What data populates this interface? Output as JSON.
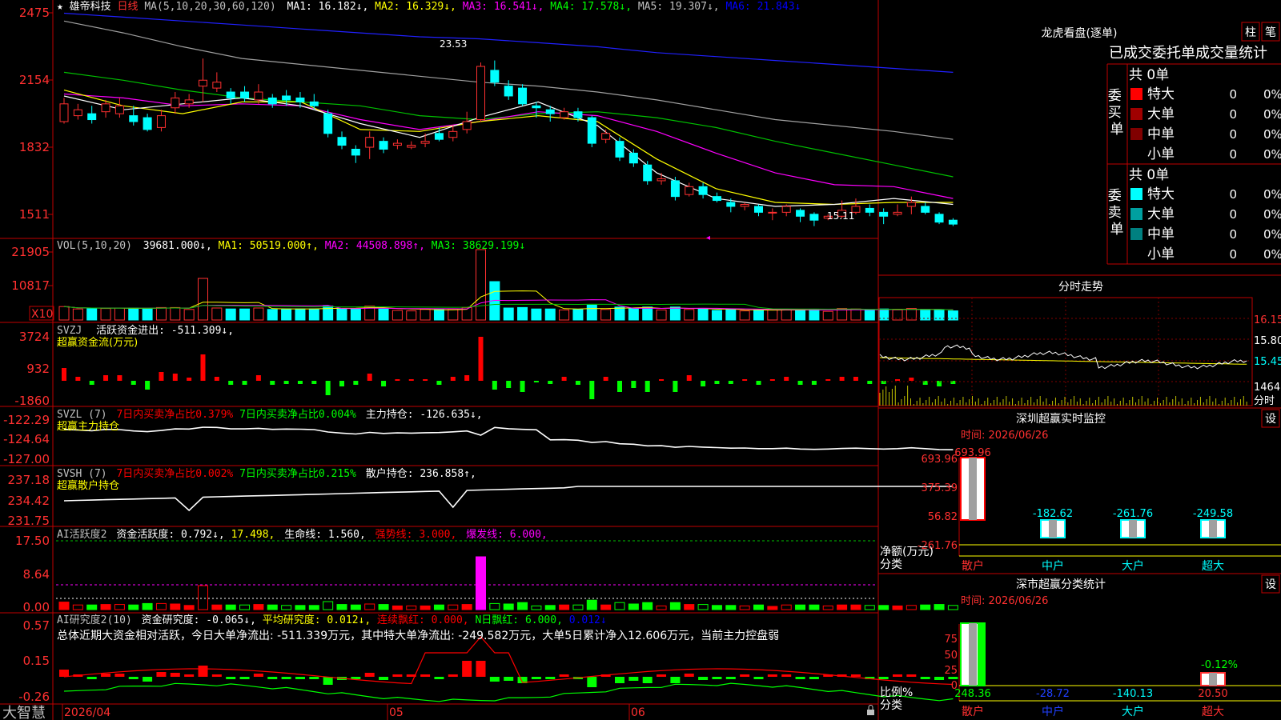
{
  "stock": {
    "star": "★",
    "name": "雄帝科技",
    "period": "日线"
  },
  "ma_line": {
    "label": "MA(5,10,20,30,60,120)",
    "items": [
      {
        "text": "MA1: 16.182↓,",
        "color": "#ffffff"
      },
      {
        "text": "MA2: 16.329↓,",
        "color": "#ffff00"
      },
      {
        "text": "MA3: 16.541↓,",
        "color": "#ff00ff"
      },
      {
        "text": "MA4: 17.578↓,",
        "color": "#00ff00"
      },
      {
        "text": "MA5: 19.307↓,",
        "color": "#c0c0c0"
      },
      {
        "text": "MA6: 21.843↓",
        "color": "#0000ff"
      }
    ]
  },
  "price_panel": {
    "ticks": [
      "2475",
      "2154",
      "1832",
      "1511"
    ],
    "high_label": "23.53",
    "low_label": "15.11",
    "ma_series": [
      {
        "name": "MA6",
        "color": "#2020ff",
        "values": [
          25.9,
          25.7,
          25.5,
          25.3,
          25.1,
          24.9,
          24.7,
          24.6,
          24.4,
          24.2,
          23.9,
          23.7,
          23.5,
          23.3,
          23.1,
          22.9
        ]
      },
      {
        "name": "MA5",
        "color": "#a0a0a0",
        "values": [
          25.5,
          24.9,
          24.2,
          23.6,
          23.3,
          23.0,
          22.7,
          22.4,
          22.2,
          21.9,
          21.5,
          21.0,
          20.5,
          20.2,
          19.9,
          19.5
        ]
      },
      {
        "name": "MA4",
        "color": "#00c000",
        "values": [
          22.9,
          22.5,
          22.0,
          21.6,
          21.4,
          21.2,
          20.7,
          20.5,
          20.8,
          20.9,
          20.6,
          20.1,
          19.4,
          18.8,
          18.2,
          17.6
        ]
      },
      {
        "name": "MA3",
        "color": "#ff00ff",
        "values": [
          21.8,
          21.6,
          21.2,
          21.3,
          21.2,
          20.5,
          20.0,
          20.4,
          20.9,
          20.7,
          19.9,
          18.8,
          17.8,
          17.2,
          17.1,
          16.5
        ]
      },
      {
        "name": "MA2",
        "color": "#ffff00",
        "values": [
          22.0,
          21.2,
          20.8,
          21.4,
          21.4,
          20.0,
          19.9,
          20.4,
          20.7,
          20.4,
          18.5,
          17.0,
          16.3,
          16.2,
          16.3,
          16.3
        ]
      },
      {
        "name": "MA1",
        "color": "#ffffff",
        "values": [
          21.7,
          21.0,
          21.3,
          21.6,
          21.2,
          20.3,
          19.6,
          20.6,
          21.4,
          20.2,
          17.8,
          16.5,
          16.1,
          16.2,
          16.5,
          16.2
        ]
      }
    ],
    "candles": [
      {
        "o": 20.4,
        "c": 21.3,
        "h": 21.6,
        "l": 20.3
      },
      {
        "o": 20.7,
        "c": 21.0,
        "h": 21.3,
        "l": 20.5
      },
      {
        "o": 20.8,
        "c": 20.5,
        "h": 21.2,
        "l": 20.3
      },
      {
        "o": 20.9,
        "c": 21.3,
        "h": 21.5,
        "l": 20.6
      },
      {
        "o": 20.8,
        "c": 21.2,
        "h": 21.6,
        "l": 20.6
      },
      {
        "o": 20.7,
        "c": 20.4,
        "h": 21.2,
        "l": 20.2
      },
      {
        "o": 20.6,
        "c": 20.0,
        "h": 20.8,
        "l": 19.9
      },
      {
        "o": 20.1,
        "c": 20.7,
        "h": 21.0,
        "l": 19.9
      },
      {
        "o": 21.1,
        "c": 21.6,
        "h": 21.9,
        "l": 20.8
      },
      {
        "o": 21.3,
        "c": 21.5,
        "h": 21.8,
        "l": 21.1
      },
      {
        "o": 22.2,
        "c": 22.5,
        "h": 23.6,
        "l": 21.4
      },
      {
        "o": 22.1,
        "c": 22.4,
        "h": 22.9,
        "l": 21.9
      },
      {
        "o": 21.9,
        "c": 21.6,
        "h": 22.1,
        "l": 21.3
      },
      {
        "o": 21.9,
        "c": 21.6,
        "h": 22.2,
        "l": 21.4
      },
      {
        "o": 21.5,
        "c": 21.9,
        "h": 22.3,
        "l": 21.3
      },
      {
        "o": 21.6,
        "c": 21.3,
        "h": 21.8,
        "l": 21.1
      },
      {
        "o": 21.7,
        "c": 21.5,
        "h": 22.0,
        "l": 21.2
      },
      {
        "o": 21.6,
        "c": 21.4,
        "h": 21.9,
        "l": 21.1
      },
      {
        "o": 21.4,
        "c": 21.2,
        "h": 21.8,
        "l": 21.0
      },
      {
        "o": 20.8,
        "c": 19.8,
        "h": 21.0,
        "l": 19.6
      },
      {
        "o": 19.6,
        "c": 19.2,
        "h": 19.9,
        "l": 19.0
      },
      {
        "o": 19.0,
        "c": 18.7,
        "h": 19.2,
        "l": 18.3
      },
      {
        "o": 19.1,
        "c": 19.6,
        "h": 19.9,
        "l": 18.5
      },
      {
        "o": 19.4,
        "c": 19.0,
        "h": 19.6,
        "l": 18.8
      },
      {
        "o": 19.2,
        "c": 19.3,
        "h": 19.5,
        "l": 19.0
      },
      {
        "o": 19.1,
        "c": 19.2,
        "h": 19.4,
        "l": 19.0
      },
      {
        "o": 19.3,
        "c": 19.4,
        "h": 19.8,
        "l": 19.1
      },
      {
        "o": 19.8,
        "c": 19.5,
        "h": 20.1,
        "l": 19.4
      },
      {
        "o": 19.6,
        "c": 19.9,
        "h": 20.2,
        "l": 19.4
      },
      {
        "o": 20.0,
        "c": 20.4,
        "h": 20.9,
        "l": 19.8
      },
      {
        "o": 20.5,
        "c": 23.2,
        "h": 23.4,
        "l": 20.4
      },
      {
        "o": 23.0,
        "c": 22.4,
        "h": 23.5,
        "l": 22.2
      },
      {
        "o": 22.2,
        "c": 21.7,
        "h": 22.5,
        "l": 21.5
      },
      {
        "o": 22.1,
        "c": 21.3,
        "h": 22.3,
        "l": 21.2
      },
      {
        "o": 21.2,
        "c": 21.1,
        "h": 21.4,
        "l": 20.6
      },
      {
        "o": 21.0,
        "c": 20.8,
        "h": 21.2,
        "l": 20.4
      },
      {
        "o": 20.6,
        "c": 20.9,
        "h": 21.1,
        "l": 20.5
      },
      {
        "o": 20.9,
        "c": 20.6,
        "h": 21.1,
        "l": 20.4
      },
      {
        "o": 20.6,
        "c": 19.3,
        "h": 20.7,
        "l": 19.1
      },
      {
        "o": 19.5,
        "c": 19.8,
        "h": 20.0,
        "l": 19.3
      },
      {
        "o": 19.4,
        "c": 18.6,
        "h": 19.6,
        "l": 18.4
      },
      {
        "o": 18.8,
        "c": 18.3,
        "h": 19.0,
        "l": 18.1
      },
      {
        "o": 18.2,
        "c": 17.4,
        "h": 18.4,
        "l": 17.2
      },
      {
        "o": 17.4,
        "c": 17.5,
        "h": 17.8,
        "l": 17.2
      },
      {
        "o": 17.4,
        "c": 16.6,
        "h": 17.6,
        "l": 16.4
      },
      {
        "o": 16.7,
        "c": 17.1,
        "h": 17.3,
        "l": 16.6
      },
      {
        "o": 17.1,
        "c": 16.7,
        "h": 17.3,
        "l": 16.5
      },
      {
        "o": 16.6,
        "c": 16.4,
        "h": 16.8,
        "l": 16.3
      },
      {
        "o": 16.3,
        "c": 16.1,
        "h": 16.5,
        "l": 15.8
      },
      {
        "o": 16.1,
        "c": 16.2,
        "h": 16.3,
        "l": 15.9
      },
      {
        "o": 16.1,
        "c": 15.8,
        "h": 16.2,
        "l": 15.6
      },
      {
        "o": 15.8,
        "c": 15.8,
        "h": 16.0,
        "l": 15.4
      },
      {
        "o": 15.8,
        "c": 16.1,
        "h": 16.2,
        "l": 15.6
      },
      {
        "o": 15.9,
        "c": 15.6,
        "h": 16.0,
        "l": 15.3
      },
      {
        "o": 15.7,
        "c": 15.4,
        "h": 15.8,
        "l": 15.1
      },
      {
        "o": 15.5,
        "c": 15.6,
        "h": 15.7,
        "l": 15.4
      },
      {
        "o": 15.6,
        "c": 15.9,
        "h": 16.4,
        "l": 15.5
      },
      {
        "o": 15.8,
        "c": 16.1,
        "h": 16.5,
        "l": 15.7
      },
      {
        "o": 16.0,
        "c": 15.8,
        "h": 16.2,
        "l": 15.6
      },
      {
        "o": 15.8,
        "c": 15.6,
        "h": 16.0,
        "l": 15.2
      },
      {
        "o": 15.7,
        "c": 15.8,
        "h": 16.2,
        "l": 15.6
      },
      {
        "o": 16.1,
        "c": 16.3,
        "h": 16.6,
        "l": 15.7
      },
      {
        "o": 16.1,
        "c": 15.8,
        "h": 16.3,
        "l": 15.7
      },
      {
        "o": 15.7,
        "c": 15.3,
        "h": 15.8,
        "l": 15.2
      },
      {
        "o": 15.4,
        "c": 15.2,
        "h": 15.5,
        "l": 15.1
      }
    ]
  },
  "vol_panel": {
    "label": "VOL(5,10,20)",
    "items": [
      {
        "text": "39681.000↓,",
        "color": "#ffffff"
      },
      {
        "text": "MA1: 50519.000↑,",
        "color": "#ffff00"
      },
      {
        "text": "MA2: 44508.898↑,",
        "color": "#ff00ff"
      },
      {
        "text": "MA3: 38629.199↓",
        "color": "#00ff00"
      }
    ],
    "ticks": [
      "21905",
      "10817"
    ],
    "unit": "X10"
  },
  "svzj": {
    "label": "SVZJ",
    "title": "活跃资金进出: -511.309↓,",
    "subtitle": "超赢资金流(万元)",
    "ticks": [
      "3724",
      "932",
      "-1860"
    ]
  },
  "svzl": {
    "label": "SVZL (7)",
    "items": [
      {
        "text": "7日内买卖净占比0.379%",
        "color": "#ff0000"
      },
      {
        "text": "7日内买卖净占比0.004%",
        "color": "#00ff00"
      },
      {
        "text": "主力持仓: -126.635↓,",
        "color": "#ffffff"
      }
    ],
    "subtitle": "超赢主力持仓",
    "ticks": [
      "-122.29",
      "-124.64",
      "-127.00"
    ]
  },
  "svsh": {
    "label": "SVSH (7)",
    "items": [
      {
        "text": "7日内买卖净占比0.002%",
        "color": "#ff0000"
      },
      {
        "text": "7日内买卖净占比0.215%",
        "color": "#00ff00"
      },
      {
        "text": "散户持仓: 236.858↑,",
        "color": "#ffffff"
      }
    ],
    "subtitle": "超赢散户持仓",
    "ticks": [
      "237.18",
      "234.42",
      "231.75"
    ]
  },
  "ai_active": {
    "label": "AI活跃度2",
    "items": [
      {
        "text": "资金活跃度: 0.792↓,",
        "color": "#ffffff"
      },
      {
        "text": "17.498,",
        "color": "#ffff00"
      },
      {
        "text": "生命线: 1.560,",
        "color": "#ffffff"
      },
      {
        "text": "强势线: 3.000,",
        "color": "#ff0000"
      },
      {
        "text": "爆发线: 6.000,",
        "color": "#ff00ff"
      }
    ],
    "ticks": [
      "17.50",
      "8.64",
      "0.00"
    ]
  },
  "ai_research": {
    "label": "AI研究度2(10)",
    "items": [
      {
        "text": "资金研究度: -0.065↓,",
        "color": "#ffffff"
      },
      {
        "text": "平均研究度: 0.012↓,",
        "color": "#ffff00"
      },
      {
        "text": "连续飘红: 0.000,",
        "color": "#ff0000"
      },
      {
        "text": "N日飘红: 6.000,",
        "color": "#00ff00"
      },
      {
        "text": "0.012↓",
        "color": "#0000ff"
      }
    ],
    "summary": "总体近期大资金相对活跃，今日大单净流出: -511.339万元，其中特大单净流出: -249.582万元，大单5日累计净入12.606万元，当前主力控盘弱",
    "ticks": [
      "0.57",
      "0.15",
      "-0.26"
    ]
  },
  "bottom_bar": {
    "brand": "大智慧",
    "dates": [
      "2026/04",
      "05",
      "06"
    ]
  },
  "dragon": {
    "title": "龙虎看盘(逐单)",
    "btn_zhu": "柱",
    "btn_bi": "笔",
    "stats_title": "已成交委托单成交量统计",
    "buy_label": "委买单",
    "sell_label": "委卖单",
    "buy_total": "共 0单",
    "sell_total": "共 0单",
    "buy_rows": [
      {
        "name": "特大",
        "count": "0",
        "pct": "0%",
        "color": "#ff0000"
      },
      {
        "name": "大单",
        "count": "0",
        "pct": "0%",
        "color": "#a00000"
      },
      {
        "name": "中单",
        "count": "0",
        "pct": "0%",
        "color": "#800000"
      },
      {
        "name": "小单",
        "count": "0",
        "pct": "0%",
        "color": ""
      }
    ],
    "sell_rows": [
      {
        "name": "特大",
        "count": "0",
        "pct": "0%",
        "color": "#00ffff"
      },
      {
        "name": "大单",
        "count": "0",
        "pct": "0%",
        "color": "#00a0a0"
      },
      {
        "name": "中单",
        "count": "0",
        "pct": "0%",
        "color": "#008080"
      },
      {
        "name": "小单",
        "count": "0",
        "pct": "0%",
        "color": ""
      }
    ]
  },
  "intraday": {
    "title": "分时走势",
    "ticks": [
      "16.15",
      "15.80",
      "15.45",
      "1464"
    ],
    "vol_label": "分时"
  },
  "sz_monitor": {
    "title": "深圳超赢实时监控",
    "set": "设",
    "time": "时间: 2026/06/26",
    "ticks": [
      "693.96",
      "375.39",
      "56.82",
      "-261.76"
    ],
    "axis_label_1": "净额(万元)",
    "axis_label_2": "分类",
    "bars": [
      {
        "cat": "散户",
        "value": "693.96",
        "color": "#ff0000"
      },
      {
        "cat": "中户",
        "value": "-182.62",
        "color": "#00ffff"
      },
      {
        "cat": "大户",
        "value": "-261.76",
        "color": "#00ffff"
      },
      {
        "cat": "超大",
        "value": "-249.58",
        "color": "#00ffff"
      }
    ]
  },
  "sz_class": {
    "title": "深市超赢分类统计",
    "set": "设",
    "time": "时间: 2026/06/26",
    "ticks": [
      "75",
      "50",
      "25",
      "0"
    ],
    "axis_label_1": "比例%",
    "axis_label_2": "分类",
    "bars": [
      {
        "cat": "散户",
        "value": "248.36",
        "color": "#00ff00"
      },
      {
        "cat": "中户",
        "value": "-28.72",
        "color": "#0000ff"
      },
      {
        "cat": "大户",
        "value": "-140.13",
        "color": "#00ffff"
      },
      {
        "cat": "超大",
        "value": "20.50",
        "color": "#ff0000"
      }
    ],
    "pct_label": "-0.12%"
  }
}
